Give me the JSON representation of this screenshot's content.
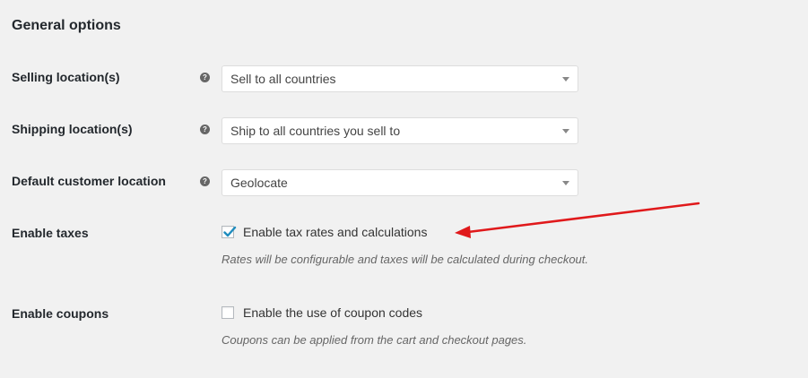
{
  "section": {
    "title": "General options"
  },
  "rows": {
    "selling": {
      "label": "Selling location(s)",
      "help": "?",
      "value": "Sell to all countries"
    },
    "shipping": {
      "label": "Shipping location(s)",
      "help": "?",
      "value": "Ship to all countries you sell to"
    },
    "default_location": {
      "label": "Default customer location",
      "help": "?",
      "value": "Geolocate"
    },
    "taxes": {
      "label": "Enable taxes",
      "checkbox_label": "Enable tax rates and calculations",
      "checked": true,
      "description": "Rates will be configurable and taxes will be calculated during checkout."
    },
    "coupons": {
      "label": "Enable coupons",
      "checkbox_label": "Enable the use of coupon codes",
      "checked": false,
      "description": "Coupons can be applied from the cart and checkout pages."
    }
  },
  "colors": {
    "background": "#f1f1f1",
    "checkmark": "#1e8cbe",
    "annotation_arrow": "#e0191b"
  },
  "icons": {
    "help": "question-circle-icon",
    "dropdown": "chevron-down-icon",
    "check": "checkmark-icon"
  }
}
